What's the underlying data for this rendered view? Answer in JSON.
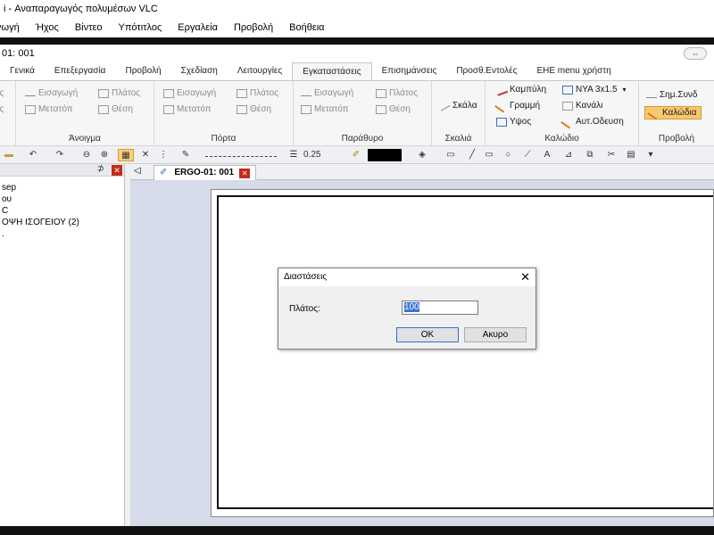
{
  "vlc": {
    "title": "i - Αναπαραγωγός πολυμέσων VLC",
    "menu": [
      "γωγή",
      "Ήχος",
      "Βίντεο",
      "Υπότιτλος",
      "Εργαλεία",
      "Προβολή",
      "Βοήθεια"
    ]
  },
  "app": {
    "title": "01: 001",
    "tabs": [
      "Γενικά",
      "Επεξεργασία",
      "Προβολή",
      "Σχεδίαση",
      "Λειτουργίες",
      "Εγκαταστάσεις",
      "Επισημάνσεις",
      "Προσθ.Εντολές",
      "EHE menu χρήστη"
    ],
    "active_tab": "Εγκαταστάσεις"
  },
  "ribbon": {
    "groups": {
      "first": {
        "items": [
          "ος",
          "ος"
        ]
      },
      "openings": {
        "label": "Άνοιγμα",
        "insert": "Εισαγωγή",
        "move": "Μετατόπ",
        "width": "Πλάτος",
        "position": "Θέση"
      },
      "door": {
        "label": "Πόρτα",
        "insert": "Εισαγωγή",
        "move": "Μετατόπ",
        "width": "Πλάτος",
        "position": "Θέση"
      },
      "window": {
        "label": "Παράθυρο",
        "insert": "Εισαγωγή",
        "move": "Μετατόπ",
        "width": "Πλάτος",
        "position": "Θέση"
      },
      "stairs": {
        "label": "Σκαλιά",
        "stair": "Σκάλα"
      },
      "cables": {
        "label": "Καλώδιο",
        "curve": "Καμπύλη",
        "line": "Γραμμή",
        "height": "Υψος",
        "nya": "NYA 3x1.5",
        "duct": "Κανάλι",
        "auto": "Αυτ.Οδευση"
      },
      "view": {
        "label": "Προβολή",
        "points": "Σημ.Συνδ",
        "cables": "Καλώδια"
      }
    }
  },
  "toolbar": {
    "line_width": "0.25"
  },
  "left_panel": {
    "items": [
      "sep",
      "ου",
      "C",
      "",
      "ΟΨΗ ΙΣΟΓΕΙΟΥ (2)",
      "."
    ]
  },
  "document": {
    "tab": "ERGO-01: 001"
  },
  "dialog": {
    "title": "Διαστάσεις",
    "field_label": "Πλάτος:",
    "field_value": "100",
    "ok": "OK",
    "cancel": "Ακυρο"
  }
}
